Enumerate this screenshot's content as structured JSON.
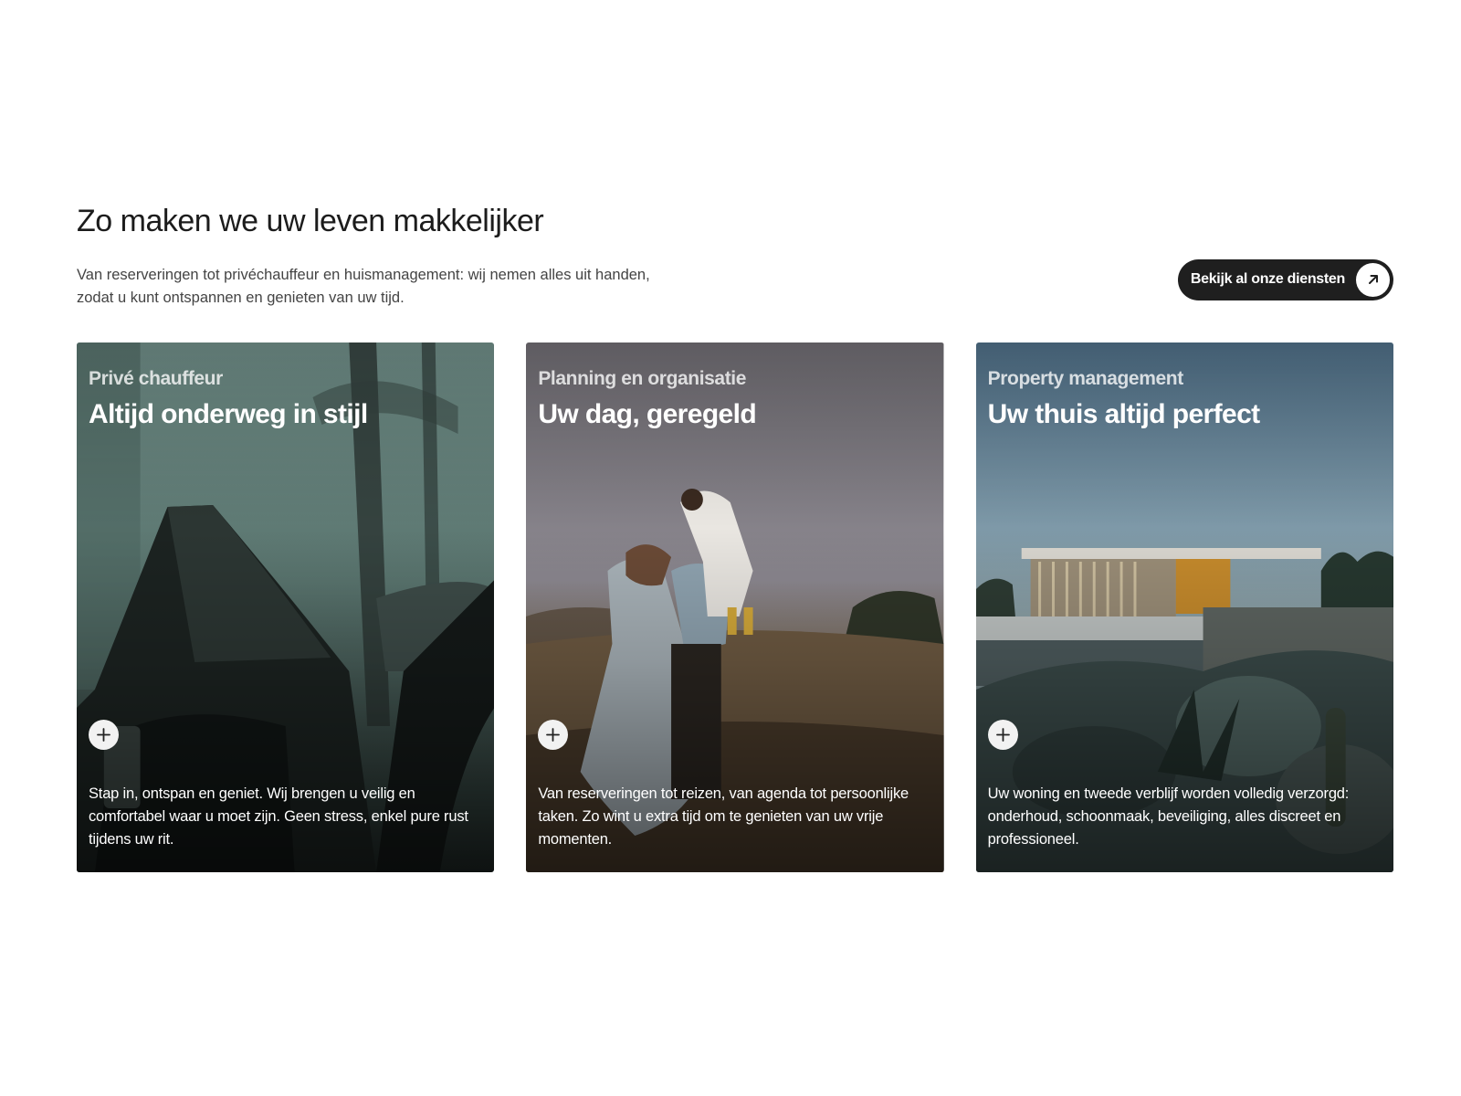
{
  "section": {
    "title": "Zo maken we uw leven makkelijker",
    "intro": "Van reserveringen tot privéchauffeur en huismanagement: wij nemen alles uit handen,\nzodat u kunt ontspannen en genieten van uw tijd.",
    "cta_label": "Bekijk al onze diensten",
    "cta_icon": "arrow-up-right-icon"
  },
  "cards": [
    {
      "eyebrow": "Privé chauffeur",
      "title": "Altijd onderweg in stijl",
      "text": "Stap in, ontspan en geniet. Wij brengen u veilig en comfortabel waar u moet zijn. Geen stress, enkel pure rust tijdens uw rit.",
      "icon": "plus-icon"
    },
    {
      "eyebrow": "Planning en organisatie",
      "title": "Uw dag, geregeld",
      "text": "Van reserveringen tot reizen, van agenda tot persoonlijke taken. Zo wint u extra tijd om te genieten van uw vrije momenten.",
      "icon": "plus-icon"
    },
    {
      "eyebrow": "Property management",
      "title": "Uw thuis altijd perfect",
      "text": "Uw woning en tweede verblijf worden volledig verzorgd: onderhoud, schoonmaak, beveiliging, alles discreet en professioneel.",
      "icon": "plus-icon"
    }
  ]
}
